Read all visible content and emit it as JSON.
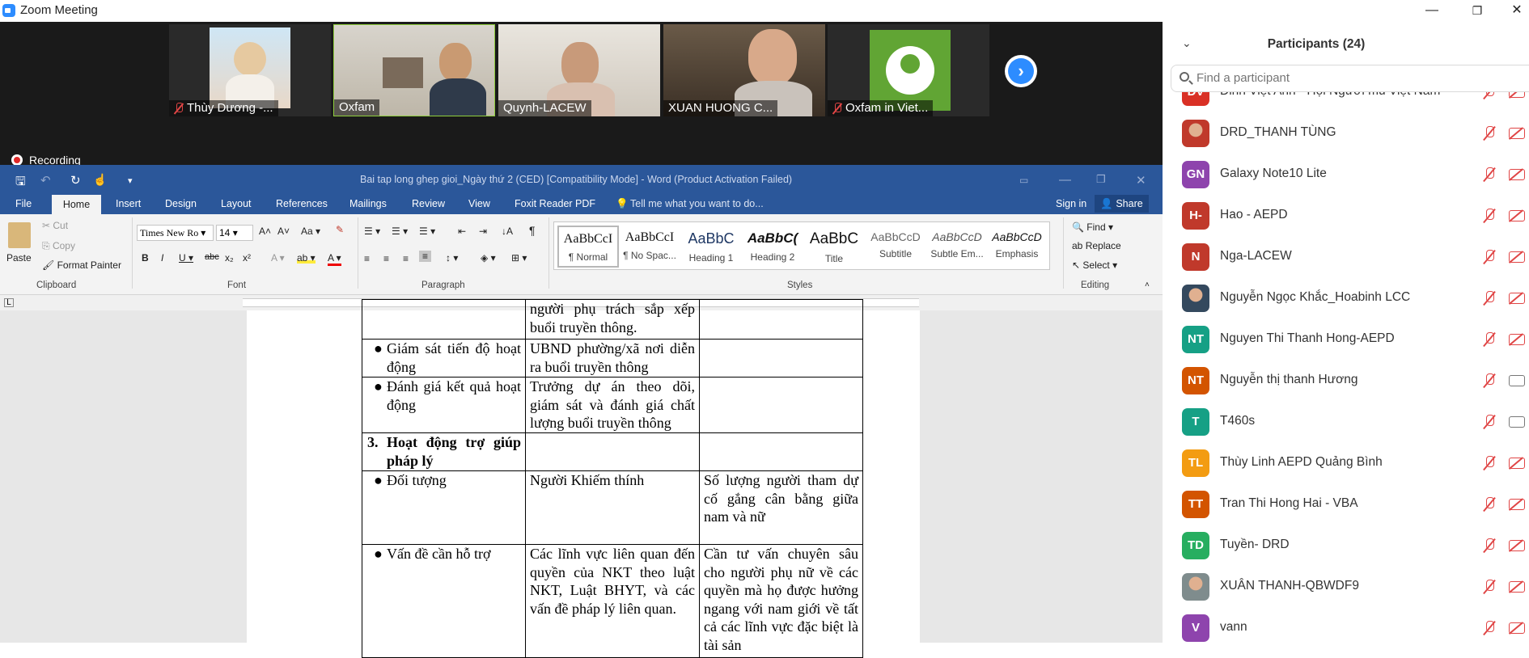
{
  "window": {
    "title": "Zoom Meeting",
    "minimize": "—",
    "restore": "❐",
    "close": "✕"
  },
  "videos": [
    {
      "name": "Thùy Dương -...",
      "muted": true
    },
    {
      "name": "Oxfam",
      "muted": false
    },
    {
      "name": "Quynh-LACEW",
      "muted": false
    },
    {
      "name": "XUAN HUONG C...",
      "muted": false
    },
    {
      "name": "Oxfam in Viet...",
      "muted": true
    }
  ],
  "next_label": "›",
  "recording_label": "Recording",
  "word": {
    "title": "Bai tap long ghep gioi_Ngày thứ 2 (CED) [Compatibility Mode] - Word (Product Activation Failed)",
    "tabs": [
      "File",
      "Home",
      "Insert",
      "Design",
      "Layout",
      "References",
      "Mailings",
      "Review",
      "View",
      "Foxit Reader PDF"
    ],
    "tell_me": "Tell me what you want to do...",
    "sign_in": "Sign in",
    "share": "Share",
    "clipboard": {
      "paste": "Paste",
      "cut": "Cut",
      "copy": "Copy",
      "format_painter": "Format Painter",
      "label": "Clipboard"
    },
    "font": {
      "name": "Times New Ro",
      "size": "14",
      "label": "Font"
    },
    "paragraph_label": "Paragraph",
    "styles_label": "Styles",
    "editing": {
      "find": "Find",
      "replace": "Replace",
      "select": "Select",
      "label": "Editing"
    },
    "styles": [
      {
        "sample": "AaBbCcI",
        "name": "¶ Normal"
      },
      {
        "sample": "AaBbCcI",
        "name": "¶ No Spac..."
      },
      {
        "sample": "AaBbC",
        "name": "Heading 1"
      },
      {
        "sample": "AaBbC(",
        "name": "Heading 2"
      },
      {
        "sample": "AaBbC",
        "name": "Title"
      },
      {
        "sample": "AaBbCcD",
        "name": "Subtitle"
      },
      {
        "sample": "AaBbCcD",
        "name": "Subtle Em..."
      },
      {
        "sample": "AaBbCcD",
        "name": "Emphasis"
      }
    ]
  },
  "doc_table": {
    "r0": {
      "c1": "người phụ trách sắp xếp buổi truyền thông."
    },
    "r1": {
      "c0": "Giám sát tiến độ hoạt động",
      "c1": "UBND phường/xã nơi diễn ra buổi truyền thông"
    },
    "r2": {
      "c0": "Đánh giá kết quả hoạt động",
      "c1": "Trưởng dự án theo dõi, giám sát và đánh giá chất lượng buổi truyền thông"
    },
    "r3": {
      "num": "3.",
      "c0": "Hoạt động trợ giúp pháp lý"
    },
    "r4": {
      "c0": "Đối tượng",
      "c1": "Người Khiếm thính",
      "c2": "Số lượng người tham dự cố gắng cân bằng giữa nam và nữ"
    },
    "r5": {
      "c0": "Vấn đề cần hỗ trợ",
      "c1": "Các lĩnh vực liên quan đến quyền của NKT theo luật NKT, Luật BHYT, và các vấn đề pháp lý liên quan.",
      "c2": "Cần tư vấn chuyên sâu cho người phụ nữ về các quyền mà họ được hưởng ngang với nam giới về tất cả các lĩnh vực đặc biệt là tài sản"
    }
  },
  "participants": {
    "title": "Participants (24)",
    "search_placeholder": "Find a participant",
    "list": [
      {
        "initials": "ĐV",
        "name": "Đinh Việt Anh - Hội Người mù Việt Nam",
        "color": "#d93025",
        "mic": "muted",
        "cam": "off"
      },
      {
        "initials": "",
        "name": "DRD_THANH TÙNG",
        "color": "#c0392b",
        "mic": "muted",
        "cam": "off",
        "photo": true
      },
      {
        "initials": "GN",
        "name": "Galaxy Note10 Lite",
        "color": "#8e44ad",
        "mic": "muted",
        "cam": "off"
      },
      {
        "initials": "H-",
        "name": "Hao - AEPD",
        "color": "#c0392b",
        "mic": "muted",
        "cam": "off"
      },
      {
        "initials": "N",
        "name": "Nga-LACEW",
        "color": "#c0392b",
        "mic": "muted",
        "cam": "off"
      },
      {
        "initials": "",
        "name": "Nguyễn Ngọc Khắc_Hoabinh LCC",
        "color": "#34495e",
        "mic": "muted",
        "cam": "off",
        "photo": true
      },
      {
        "initials": "NT",
        "name": "Nguyen Thi Thanh Hong-AEPD",
        "color": "#16a085",
        "mic": "muted",
        "cam": "off"
      },
      {
        "initials": "NT",
        "name": "Nguyễn thị thanh Hương",
        "color": "#d35400",
        "mic": "muted",
        "cam": "on"
      },
      {
        "initials": "T",
        "name": "T460s",
        "color": "#16a085",
        "mic": "muted",
        "cam": "on"
      },
      {
        "initials": "TL",
        "name": "Thùy Linh AEPD Quảng Bình",
        "color": "#f39c12",
        "mic": "muted",
        "cam": "off"
      },
      {
        "initials": "TT",
        "name": "Tran Thi Hong Hai - VBA",
        "color": "#d35400",
        "mic": "muted",
        "cam": "off"
      },
      {
        "initials": "TD",
        "name": "Tuyền- DRD",
        "color": "#27ae60",
        "mic": "muted",
        "cam": "off"
      },
      {
        "initials": "",
        "name": "XUÂN THANH-QBWDF9",
        "color": "#7f8c8d",
        "mic": "muted",
        "cam": "off",
        "photo": true
      },
      {
        "initials": "V",
        "name": "vann",
        "color": "#8e44ad",
        "mic": "muted",
        "cam": "off"
      }
    ]
  }
}
